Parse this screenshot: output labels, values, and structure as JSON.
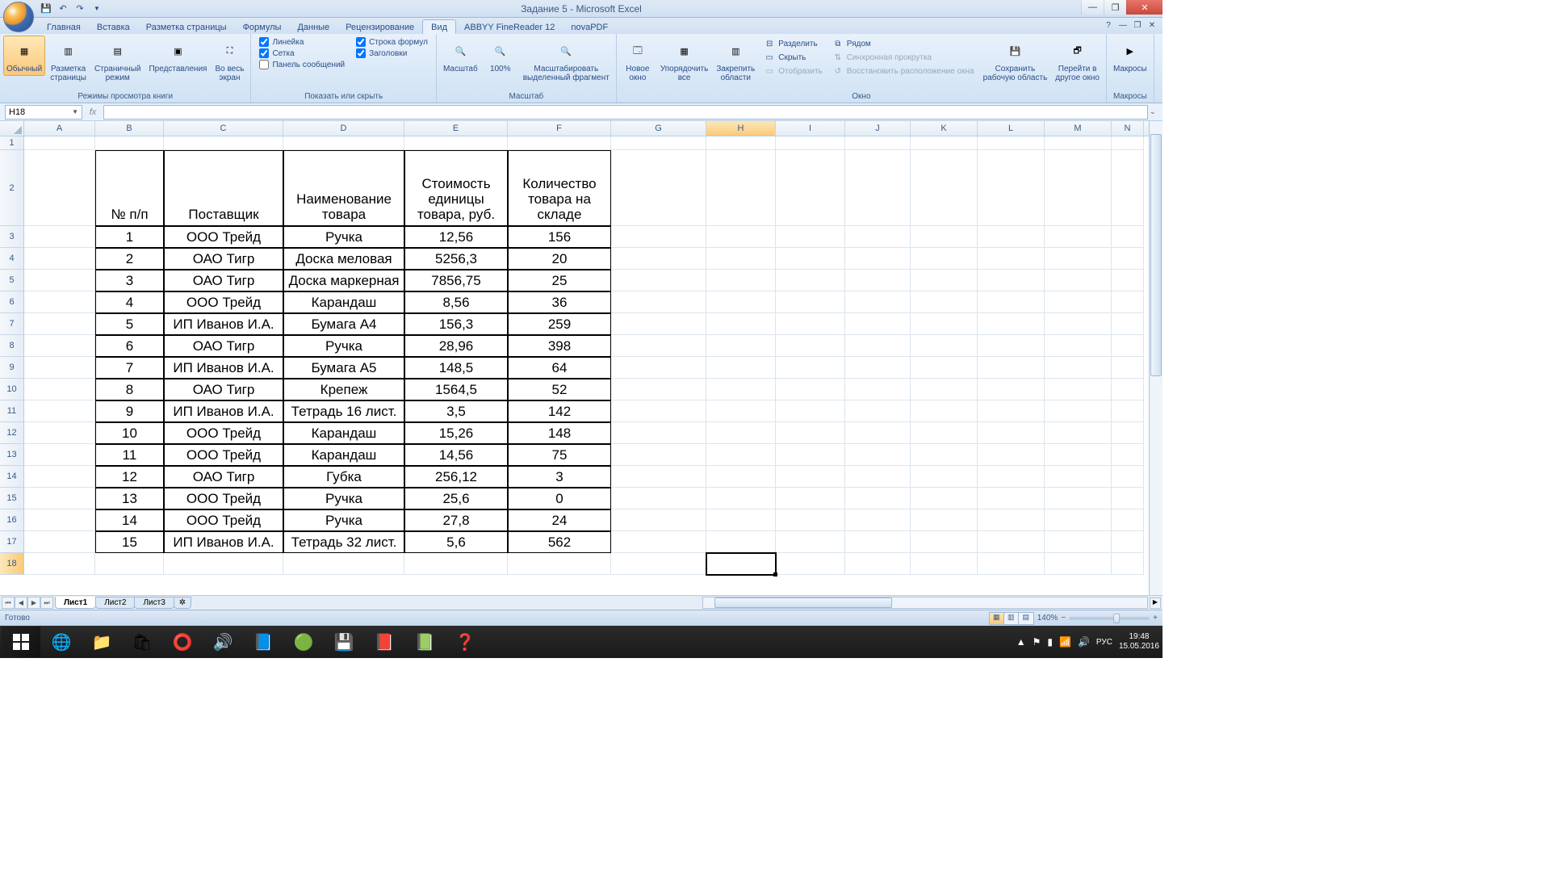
{
  "window": {
    "title": "Задание 5 - Microsoft Excel"
  },
  "tabs": {
    "home": "Главная",
    "insert": "Вставка",
    "layout": "Разметка страницы",
    "formulas": "Формулы",
    "data": "Данные",
    "review": "Рецензирование",
    "view": "Вид",
    "abbyy": "ABBYY FineReader 12",
    "nova": "novaPDF"
  },
  "ribbon": {
    "g1": {
      "normal": "Обычный",
      "page_layout": "Разметка\nстраницы",
      "page_break": "Страничный\nрежим",
      "custom": "Представления",
      "full": "Во весь\nэкран",
      "label": "Режимы просмотра книги"
    },
    "g2": {
      "ruler": "Линейка",
      "grid": "Сетка",
      "msgpanel": "Панель сообщений",
      "fbar": "Строка формул",
      "headings": "Заголовки",
      "label": "Показать или скрыть"
    },
    "g3": {
      "zoom": "Масштаб",
      "z100": "100%",
      "zoom_sel": "Масштабировать\nвыделенный фрагмент",
      "label": "Масштаб"
    },
    "g4": {
      "new_win": "Новое\nокно",
      "arrange": "Упорядочить\nвсе",
      "freeze": "Закрепить\nобласти",
      "split": "Разделить",
      "hide": "Скрыть",
      "unhide": "Отобразить",
      "side": "Рядом",
      "sync": "Синхронная прокрутка",
      "reset": "Восстановить расположение окна",
      "save_ws": "Сохранить\nрабочую область",
      "switch": "Перейти в\nдругое окно",
      "label": "Окно"
    },
    "g5": {
      "macros": "Макросы",
      "label": "Макросы"
    }
  },
  "namebox": "H18",
  "cols": [
    "A",
    "B",
    "C",
    "D",
    "E",
    "F",
    "G",
    "H",
    "I",
    "J",
    "K",
    "L",
    "M",
    "N"
  ],
  "header_row": [
    "№ п/п",
    "Поставщик",
    "Наименование товара",
    "Стоимость единицы товара, руб.",
    "Количество товара на складе"
  ],
  "rows": [
    {
      "n": "1",
      "sup": "ООО Трейд",
      "name": "Ручка",
      "price": "12,56",
      "qty": "156"
    },
    {
      "n": "2",
      "sup": "ОАО Тигр",
      "name": "Доска меловая",
      "price": "5256,3",
      "qty": "20"
    },
    {
      "n": "3",
      "sup": "ОАО Тигр",
      "name": "Доска маркерная",
      "price": "7856,75",
      "qty": "25"
    },
    {
      "n": "4",
      "sup": "ООО Трейд",
      "name": "Карандаш",
      "price": "8,56",
      "qty": "36"
    },
    {
      "n": "5",
      "sup": "ИП Иванов И.А.",
      "name": "Бумага А4",
      "price": "156,3",
      "qty": "259"
    },
    {
      "n": "6",
      "sup": "ОАО Тигр",
      "name": "Ручка",
      "price": "28,96",
      "qty": "398"
    },
    {
      "n": "7",
      "sup": "ИП Иванов И.А.",
      "name": "Бумага А5",
      "price": "148,5",
      "qty": "64"
    },
    {
      "n": "8",
      "sup": "ОАО Тигр",
      "name": "Крепеж",
      "price": "1564,5",
      "qty": "52"
    },
    {
      "n": "9",
      "sup": "ИП Иванов И.А.",
      "name": "Тетрадь 16 лист.",
      "price": "3,5",
      "qty": "142"
    },
    {
      "n": "10",
      "sup": "ООО Трейд",
      "name": "Карандаш",
      "price": "15,26",
      "qty": "148"
    },
    {
      "n": "11",
      "sup": "ООО Трейд",
      "name": "Карандаш",
      "price": "14,56",
      "qty": "75"
    },
    {
      "n": "12",
      "sup": "ОАО Тигр",
      "name": "Губка",
      "price": "256,12",
      "qty": "3"
    },
    {
      "n": "13",
      "sup": "ООО Трейд",
      "name": "Ручка",
      "price": "25,6",
      "qty": "0"
    },
    {
      "n": "14",
      "sup": "ООО Трейд",
      "name": "Ручка",
      "price": "27,8",
      "qty": "24"
    },
    {
      "n": "15",
      "sup": "ИП Иванов И.А.",
      "name": "Тетрадь 32 лист.",
      "price": "5,6",
      "qty": "562"
    }
  ],
  "sheets": {
    "s1": "Лист1",
    "s2": "Лист2",
    "s3": "Лист3"
  },
  "status": {
    "ready": "Готово",
    "zoom": "140%",
    "lang": "РУС"
  },
  "tray": {
    "time": "19:48",
    "date": "15.05.2016"
  }
}
